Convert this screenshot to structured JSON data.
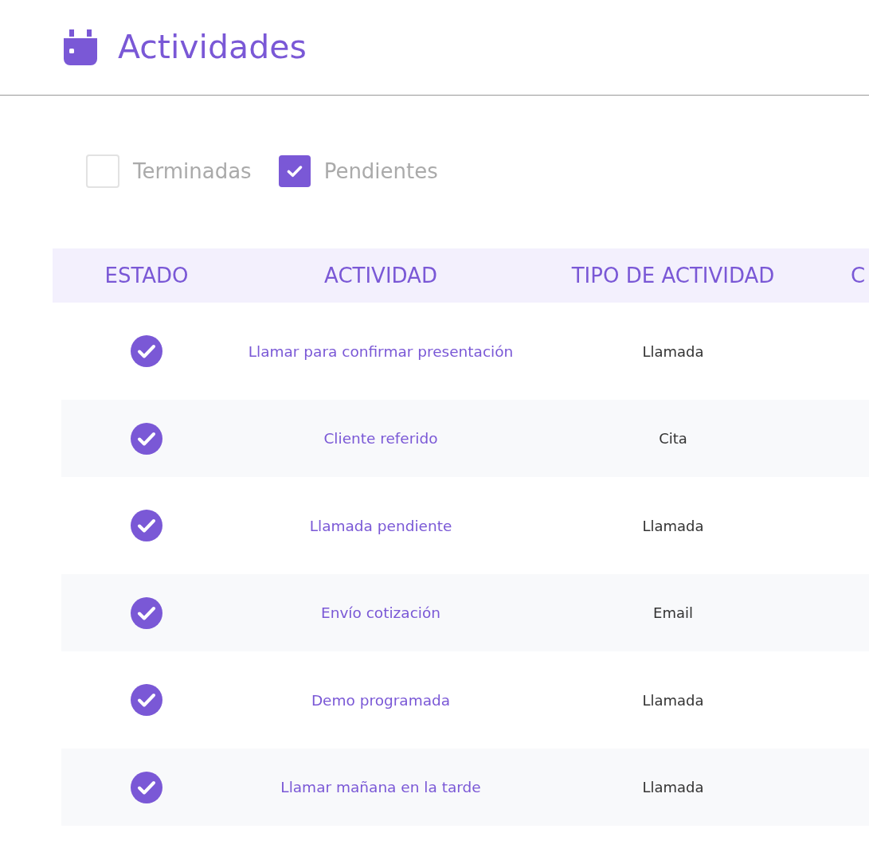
{
  "header": {
    "title": "Actividades"
  },
  "filters": [
    {
      "label": "Terminadas",
      "checked": false
    },
    {
      "label": "Pendientes",
      "checked": true
    }
  ],
  "table": {
    "columns": [
      "ESTADO",
      "ACTIVIDAD",
      "TIPO DE ACTIVIDAD",
      "C"
    ],
    "rows": [
      {
        "done": true,
        "activity": "Llamar para confirmar presentación",
        "type": "Llamada"
      },
      {
        "done": true,
        "activity": "Cliente referido",
        "type": "Cita"
      },
      {
        "done": true,
        "activity": "Llamada pendiente",
        "type": "Llamada"
      },
      {
        "done": true,
        "activity": "Envío cotización",
        "type": "Email"
      },
      {
        "done": true,
        "activity": "Demo programada",
        "type": "Llamada"
      },
      {
        "done": true,
        "activity": "Llamar mañana en la tarde",
        "type": "Llamada"
      }
    ]
  }
}
